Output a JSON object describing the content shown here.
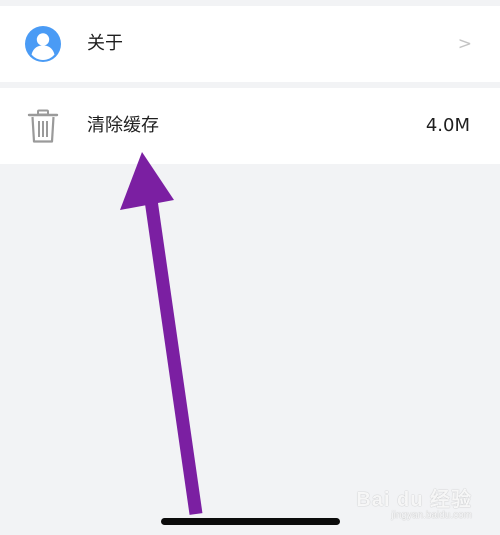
{
  "settings": {
    "rows": [
      {
        "label": "关于",
        "icon": "user-avatar-icon",
        "trailing": ">"
      },
      {
        "label": "清除缓存",
        "icon": "trash-icon",
        "value": "4.0M"
      }
    ]
  },
  "colors": {
    "background": "#f2f3f5",
    "row_background": "#ffffff",
    "avatar_blue": "#4a9bf5",
    "icon_gray": "#9a9a9a",
    "arrow_purple": "#7b1fa2"
  },
  "watermark": {
    "main": "Bai du 经验",
    "sub": "jingyan.baidu.com"
  }
}
